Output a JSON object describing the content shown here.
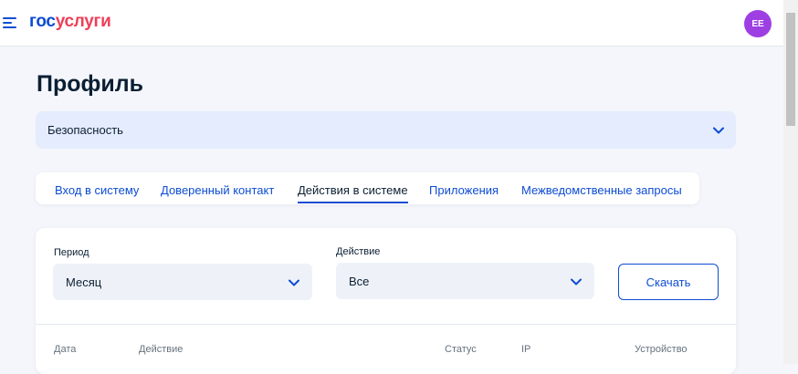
{
  "header": {
    "logo_part1": "гос",
    "logo_part2": "услуги",
    "avatar_initials": "ЕЕ",
    "colors": {
      "brand_blue": "#0d4cd3",
      "brand_red": "#ee3f58",
      "avatar": "#9e3fe3"
    }
  },
  "page": {
    "title": "Профиль"
  },
  "section_select": {
    "value": "Безопасность",
    "icon": "chevron-down-icon"
  },
  "tabs": [
    {
      "label": "Вход в систему",
      "active": false
    },
    {
      "label": "Доверенный контакт",
      "active": false
    },
    {
      "label": "Действия в системе",
      "active": true
    },
    {
      "label": "Приложения",
      "active": false
    },
    {
      "label": "Межведомственные запросы",
      "active": false
    }
  ],
  "filters": {
    "period": {
      "label": "Период",
      "value": "Месяц"
    },
    "action": {
      "label": "Действие",
      "value": "Все"
    },
    "download_label": "Скачать"
  },
  "table": {
    "columns": [
      "Дата",
      "Действие",
      "Статус",
      "IP",
      "Устройство"
    ]
  }
}
